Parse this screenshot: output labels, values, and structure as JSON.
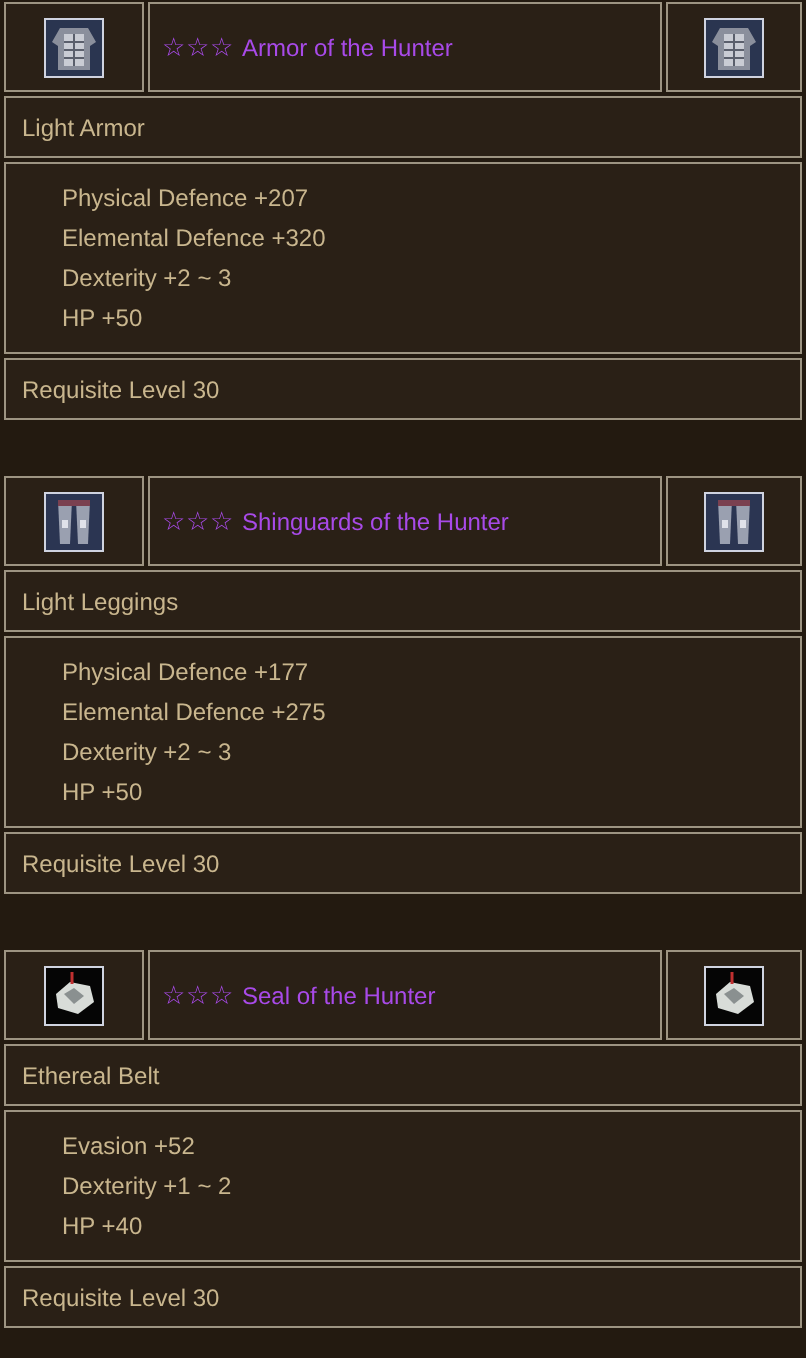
{
  "items": [
    {
      "kind": "armor",
      "rank": "☆☆☆",
      "name": "Armor of the Hunter",
      "type": "Light Armor",
      "stats": [
        "Physical Defence +207",
        "Elemental Defence +320",
        "Dexterity +2 ~ 3",
        "HP +50"
      ],
      "requirement": "Requisite Level 30"
    },
    {
      "kind": "leggings",
      "rank": "☆☆☆",
      "name": "Shinguards of the Hunter",
      "type": "Light Leggings",
      "stats": [
        "Physical Defence +177",
        "Elemental Defence +275",
        "Dexterity +2 ~ 3",
        "HP +50"
      ],
      "requirement": "Requisite Level 30"
    },
    {
      "kind": "seal",
      "rank": "☆☆☆",
      "name": "Seal of the Hunter",
      "type": "Ethereal Belt",
      "stats": [
        "Evasion +52",
        "Dexterity +1 ~ 2",
        "HP +40"
      ],
      "requirement": "Requisite Level 30"
    }
  ]
}
